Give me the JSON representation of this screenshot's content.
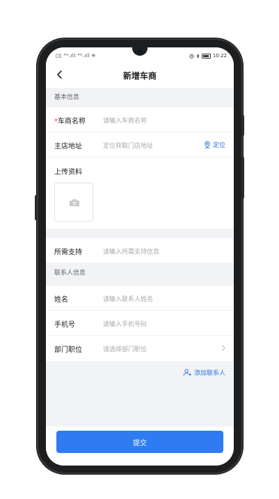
{
  "status_bar": {
    "signal": "4G",
    "time": "10:22",
    "icons": [
      "alarm-icon",
      "bluetooth-icon",
      "battery-icon"
    ]
  },
  "nav": {
    "title": "新增车商",
    "back_icon": "chevron-left-icon"
  },
  "sections": {
    "basic": "基本信息",
    "contact": "联系人信息"
  },
  "fields": {
    "dealer_name": {
      "required_mark": "*",
      "label": "车商名称",
      "placeholder": "请输入车商名称"
    },
    "store_address": {
      "label": "主店地址",
      "placeholder": "定位获取门店地址",
      "action": "定位",
      "action_icon": "location-pin-icon"
    },
    "upload": {
      "label": "上传资料",
      "icon": "camera-icon"
    },
    "support": {
      "label": "所需支持",
      "placeholder": "请输入所需支持信息"
    },
    "contact_name": {
      "label": "姓名",
      "placeholder": "请输入联系人姓名"
    },
    "phone": {
      "label": "手机号",
      "placeholder": "请输入手机号码"
    },
    "department": {
      "label": "部门职位",
      "placeholder": "请选择部门职位",
      "icon": "chevron-right-icon"
    }
  },
  "add_contact": {
    "label": "添加联系人",
    "icon": "add-user-icon"
  },
  "submit": {
    "label": "提交"
  },
  "colors": {
    "accent": "#2f7cf2",
    "link": "#2f74e8",
    "required": "#e33b3b",
    "background": "#f2f3f5",
    "placeholder": "#a6a9ad"
  }
}
